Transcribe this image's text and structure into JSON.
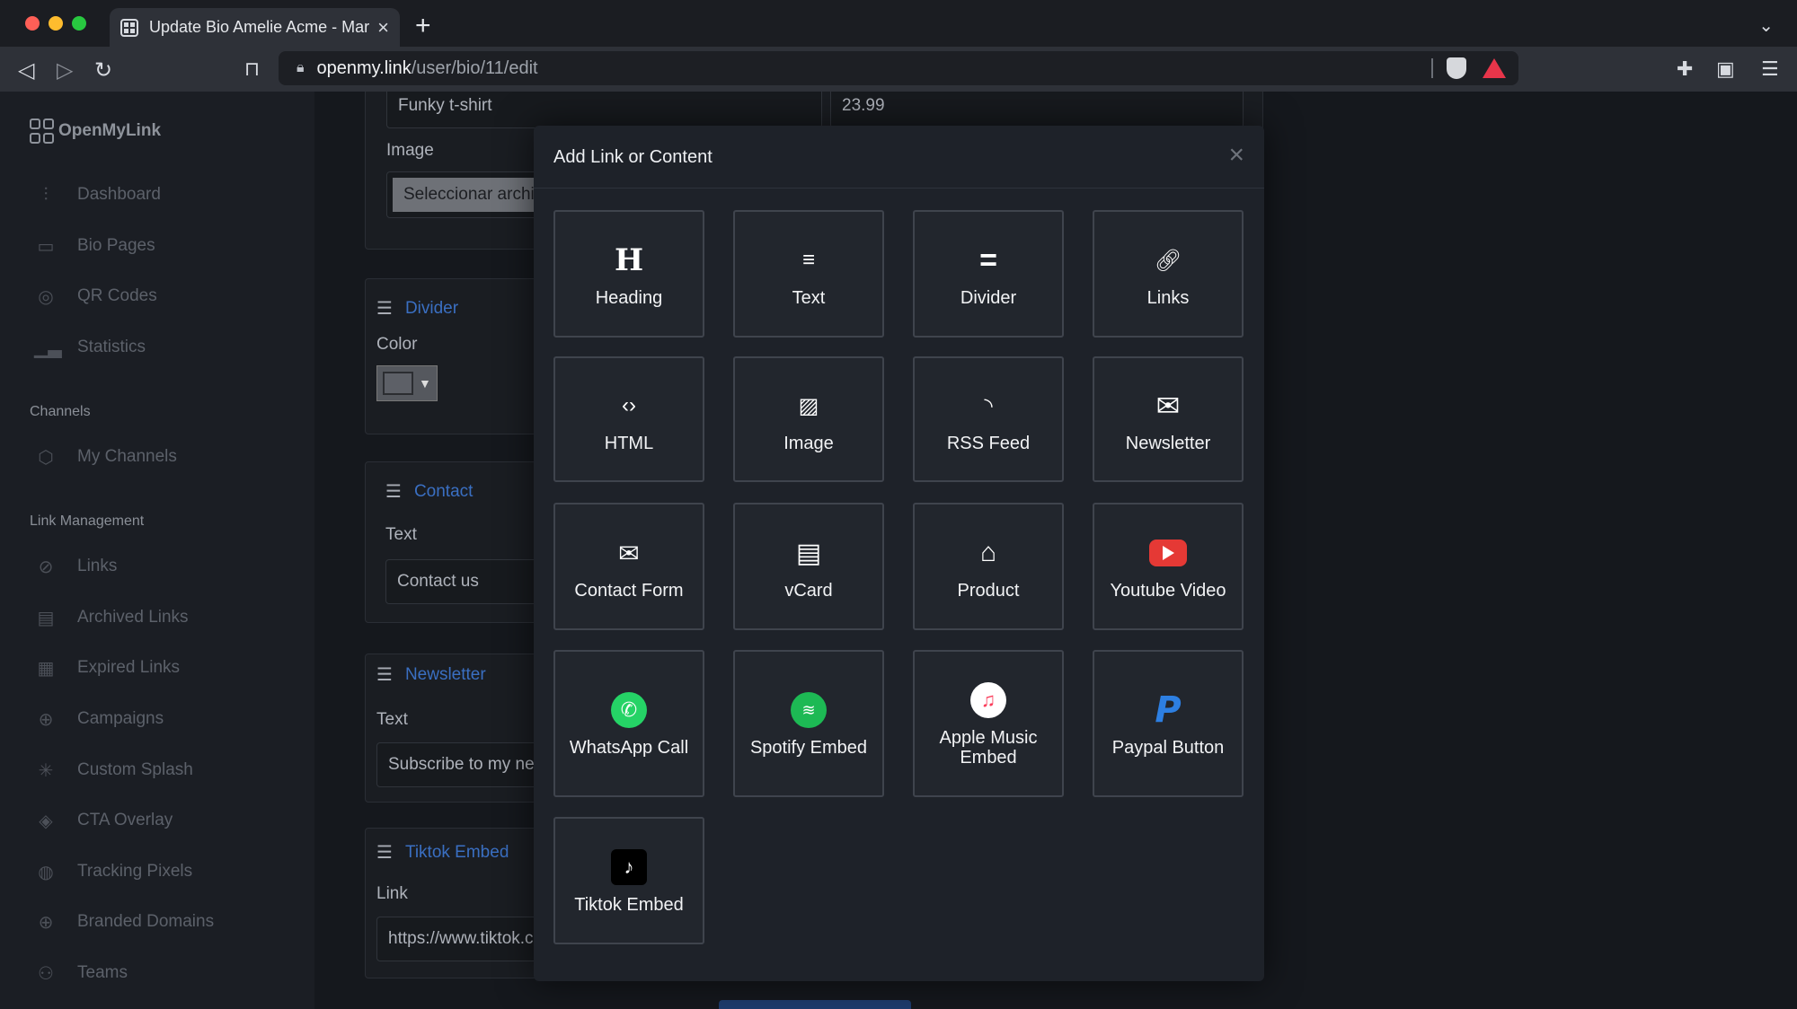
{
  "browser": {
    "tab_title": "Update Bio Amelie Acme - Mark",
    "tab_close": "×",
    "new_tab": "+",
    "url_host": "openmy.link",
    "url_path": "/user/bio/11/edit"
  },
  "sidebar": {
    "logo_text": "OpenMyLink",
    "items": [
      {
        "label": "Dashboard",
        "icon": "sliders-icon"
      },
      {
        "label": "Bio Pages",
        "icon": "layout-icon"
      },
      {
        "label": "QR Codes",
        "icon": "aperture-icon"
      },
      {
        "label": "Statistics",
        "icon": "bar-chart-icon"
      }
    ],
    "channels_title": "Channels",
    "channels_items": [
      {
        "label": "My Channels",
        "icon": "box-icon"
      }
    ],
    "link_mgmt_title": "Link Management",
    "link_items": [
      {
        "label": "Links",
        "icon": "link-icon"
      },
      {
        "label": "Archived Links",
        "icon": "briefcase-icon"
      },
      {
        "label": "Expired Links",
        "icon": "calendar-icon"
      },
      {
        "label": "Campaigns",
        "icon": "crosshair-icon"
      },
      {
        "label": "Custom Splash",
        "icon": "loader-icon"
      },
      {
        "label": "CTA Overlay",
        "icon": "layers-icon"
      },
      {
        "label": "Tracking Pixels",
        "icon": "compass-icon"
      },
      {
        "label": "Branded Domains",
        "icon": "globe-icon"
      },
      {
        "label": "Teams",
        "icon": "users-icon"
      }
    ]
  },
  "editor": {
    "product_name": "Funky t-shirt",
    "product_price": "23.99",
    "image_label": "Image",
    "file_button": "Seleccionar archivo",
    "divider_title": "Divider",
    "color_label": "Color",
    "contact_title": "Contact",
    "contact_text_label": "Text",
    "contact_text_value": "Contact us",
    "newsletter_title": "Newsletter",
    "newsletter_text_label": "Text",
    "newsletter_text_value": "Subscribe to my newsletter",
    "tiktok_title": "Tiktok Embed",
    "tiktok_link_label": "Link",
    "tiktok_link_value": "https://www.tiktok.com/"
  },
  "modal": {
    "title": "Add Link or Content",
    "close": "×",
    "tiles": [
      {
        "label": "Heading",
        "icon": "heading-icon"
      },
      {
        "label": "Text",
        "icon": "align-center-icon"
      },
      {
        "label": "Divider",
        "icon": "equals-icon"
      },
      {
        "label": "Links",
        "icon": "link-icon"
      },
      {
        "label": "HTML",
        "icon": "code-icon"
      },
      {
        "label": "Image",
        "icon": "image-icon"
      },
      {
        "label": "RSS Feed",
        "icon": "rss-icon"
      },
      {
        "label": "Newsletter",
        "icon": "envelope-open-icon"
      },
      {
        "label": "Contact Form",
        "icon": "envelope-square-icon"
      },
      {
        "label": "vCard",
        "icon": "id-card-icon"
      },
      {
        "label": "Product",
        "icon": "store-icon"
      },
      {
        "label": "Youtube Video",
        "icon": "youtube-icon"
      },
      {
        "label": "WhatsApp Call",
        "icon": "whatsapp-icon"
      },
      {
        "label": "Spotify Embed",
        "icon": "spotify-icon"
      },
      {
        "label": "Apple Music Embed",
        "icon": "apple-music-icon"
      },
      {
        "label": "Paypal Button",
        "icon": "paypal-icon"
      },
      {
        "label": "Tiktok Embed",
        "icon": "tiktok-icon"
      }
    ]
  },
  "colors": {
    "accent_link": "#3a6fc2",
    "whatsapp": "#25d366",
    "spotify": "#1db954",
    "youtube": "#e53935",
    "paypal": "#2d7fe2"
  }
}
